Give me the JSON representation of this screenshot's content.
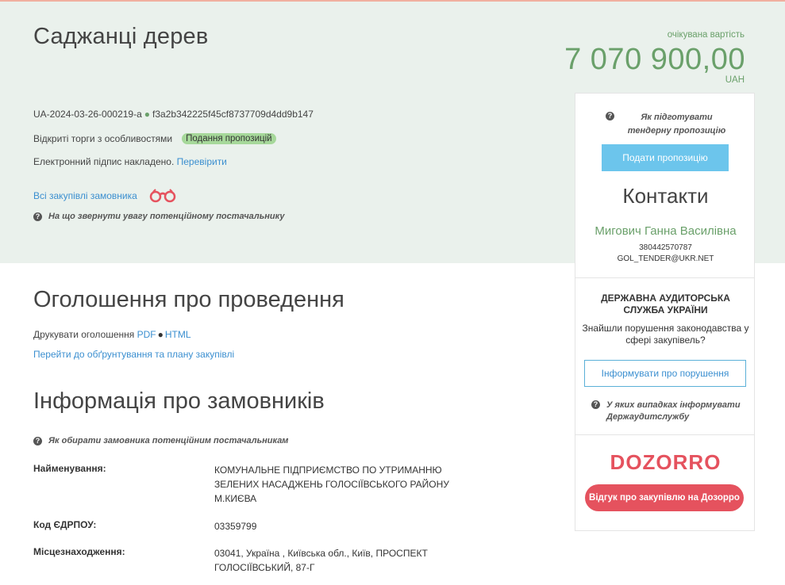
{
  "tender": {
    "title": "Саджанці дерев",
    "price_label": "очікувана вартість",
    "price": "7 070 900,00",
    "currency": "UAH",
    "tender_id": "UA-2024-03-26-000219-a",
    "hash": "f3a2b342225f45cf8737709d4dd9b147",
    "procedure": "Відкриті торги з особливостями",
    "status_badge": "Подання пропозицій",
    "signature_text": "Електронний підпис накладено.",
    "signature_link": "Перевірити",
    "all_purchases_link": "Всі закупівлі замовника",
    "supplier_hint": "На що звернути увагу потенційному постачальнику"
  },
  "announcement": {
    "heading": "Оголошення про проведення",
    "print_label": "Друкувати оголошення",
    "pdf_link": "PDF",
    "html_link": "HTML",
    "plan_link": "Перейти до обґрунтування та плану закупівлі"
  },
  "customer": {
    "heading": "Інформація про замовників",
    "hint": "Як обирати замовника потенційним постачальникам",
    "rows": [
      {
        "label": "Найменування:",
        "value": "КОМУНАЛЬНЕ ПІДПРИЄМСТВО ПО УТРИМАННЮ ЗЕЛЕНИХ НАСАДЖЕНЬ ГОЛОСІЇВСЬКОГО РАЙОНУ М.КИЄВА"
      },
      {
        "label": "Код ЄДРПОУ:",
        "value": "03359799"
      },
      {
        "label": "Місцезнаходження:",
        "value": "03041, Україна , Київська обл., Київ, ПРОСПЕКТ ГОЛОСІЇВСЬКИЙ, 87-Г"
      }
    ]
  },
  "sidebar": {
    "prep_hint": "Як підготувати тендерну пропозицію",
    "submit_button": "Подати пропозицію",
    "contacts_title": "Контакти",
    "contact_name": "Мигович Ганна Василівна",
    "contact_phone": "380442570787",
    "contact_email": "GOL_TENDER@UKR.NET",
    "dasu_title": "ДЕРЖАВНА АУДИТОРСЬКА СЛУЖБА УКРАЇНИ",
    "dasu_question": "Знайшли порушення законодавства у сфері закупівель?",
    "report_button": "Інформувати про порушення",
    "dasu_hint": "У яких випадках інформувати Держаудитслужбу",
    "dozorro_logo": "DOZORRO",
    "dozorro_button": "Відгук про закупівлю на Дозорро"
  },
  "colors": {
    "accent_green": "#6aa06a",
    "link_blue": "#3b8fd0",
    "button_blue": "#6cc5ec",
    "dozorro_red": "#e5525e",
    "header_bg": "#eaf1ec"
  }
}
